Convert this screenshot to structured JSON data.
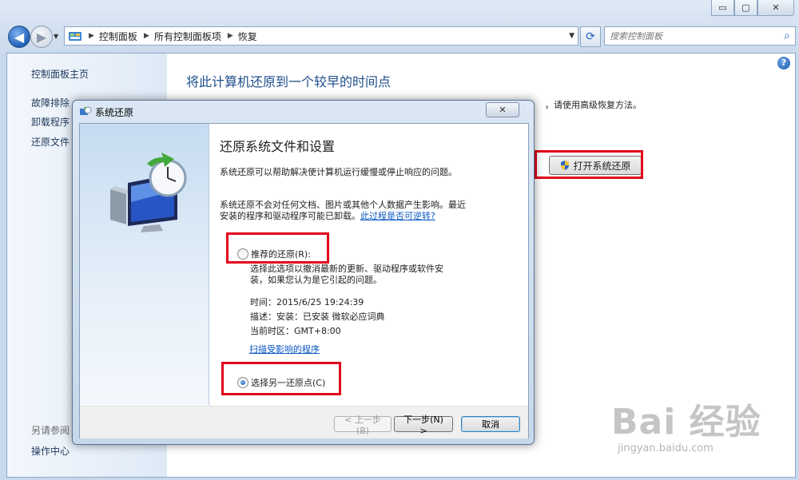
{
  "window": {
    "minimize_glyph": "▭",
    "maximize_glyph": "▢",
    "close_glyph": "✕"
  },
  "address_bar": {
    "crumbs": [
      "控制面板",
      "所有控制面板项",
      "恢复"
    ],
    "search_placeholder": "搜索控制面板"
  },
  "sidebar": {
    "home": "控制面板主页",
    "items": [
      "故障排除",
      "卸载程序",
      "还原文件"
    ],
    "see_also_heading": "另请参阅",
    "see_also_items": [
      "操作中心"
    ]
  },
  "main": {
    "title": "将此计算机还原到一个较早的时间点",
    "description": "，请使用高级恢复方法。",
    "open_restore_button": "打开系统还原"
  },
  "dialog": {
    "title": "系统还原",
    "heading": "还原系统文件和设置",
    "intro": "系统还原可以帮助解决使计算机运行缓慢或停止响应的问题。",
    "notice_line1": "系统还原不会对任何文档、图片或其他个人数据产生影响。最近",
    "notice_line2": "安装的程序和驱动程序可能已卸载。",
    "reversible_link": "此过程是否可逆转?",
    "option_recommended": "推荐的还原(R):",
    "recommended_desc_line1": "选择此选项以撤消最新的更新、驱动程序或软件安",
    "recommended_desc_line2": "装，如果您认为是它引起的问题。",
    "time_label": "时间：",
    "time_value": "2015/6/25 19:24:39",
    "desc_label": "描述：",
    "desc_value": "安装：已安装 微软必应词典",
    "tz_label": "当前时区：",
    "tz_value": "GMT+8:00",
    "scan_link": "扫描受影响的程序",
    "option_other": "选择另一还原点(C)",
    "selected_option": "option_other",
    "back_button": "< 上一步(B)",
    "next_button": "下一步(N) >",
    "cancel_button": "取消"
  },
  "watermark": {
    "text": "Bai  经验",
    "sub": "jingyan.baidu.com"
  },
  "colors": {
    "highlight": "#e0001b",
    "link": "#0a58c2",
    "title_blue": "#1e4e8c"
  }
}
